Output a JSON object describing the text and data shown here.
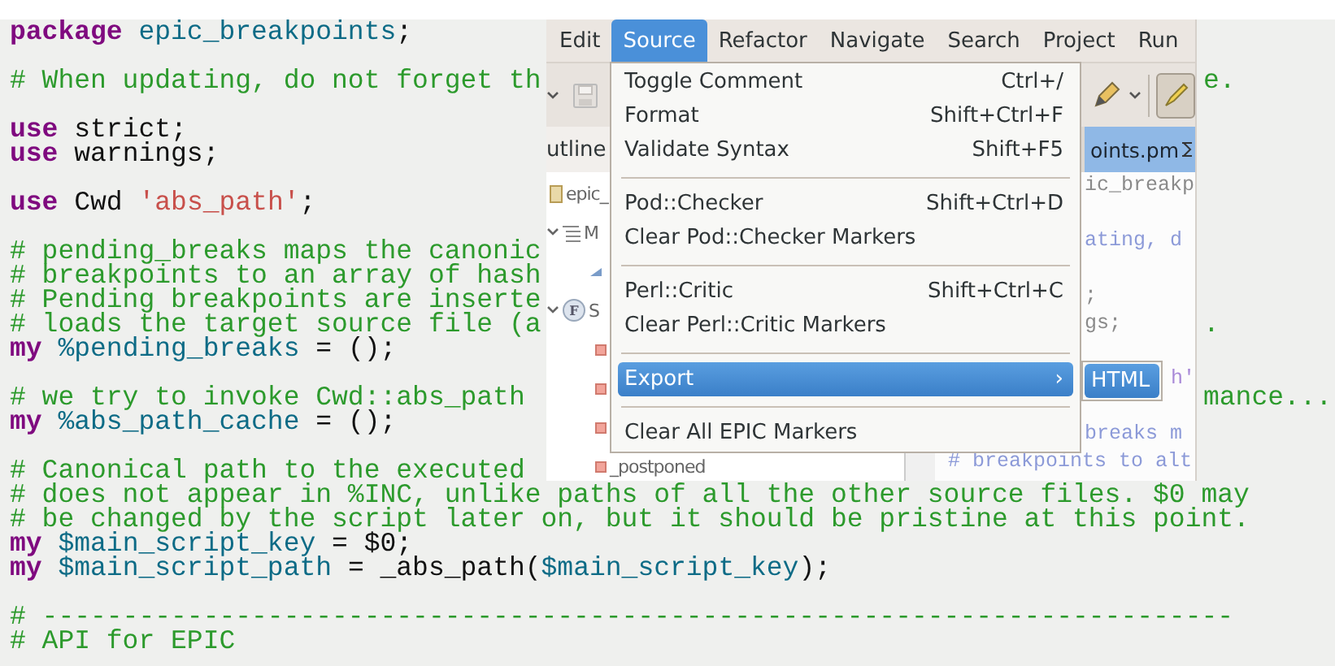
{
  "code": {
    "blocks": [
      [
        {
          "tokens": [
            {
              "kind": "keyword",
              "text": "package"
            },
            {
              "kind": "ident",
              "text": " epic_breakpoints"
            },
            {
              "kind": "plain",
              "text": ";"
            }
          ]
        }
      ],
      [
        {
          "tokens": [
            {
              "kind": "comment",
              "text": "# When updating, do not forget th"
            }
          ],
          "tail": [
            {
              "kind": "comment",
              "text": "e."
            }
          ]
        }
      ],
      [
        {
          "tokens": [
            {
              "kind": "keyword",
              "text": "use"
            },
            {
              "kind": "plain",
              "text": " strict;"
            }
          ]
        },
        {
          "tokens": [
            {
              "kind": "keyword",
              "text": "use"
            },
            {
              "kind": "plain",
              "text": " warnings;"
            }
          ]
        }
      ],
      [
        {
          "tokens": [
            {
              "kind": "keyword",
              "text": "use"
            },
            {
              "kind": "plain",
              "text": " Cwd "
            },
            {
              "kind": "string",
              "text": "'abs_path'"
            },
            {
              "kind": "plain",
              "text": ";"
            }
          ]
        }
      ],
      [
        {
          "tokens": [
            {
              "kind": "comment",
              "text": "# pending_breaks maps the canonic"
            }
          ]
        },
        {
          "tokens": [
            {
              "kind": "comment",
              "text": "# breakpoints to an array of hash"
            }
          ]
        },
        {
          "tokens": [
            {
              "kind": "comment",
              "text": "# Pending breakpoints are inserte"
            }
          ]
        },
        {
          "tokens": [
            {
              "kind": "comment",
              "text": "# loads the target source file (a"
            }
          ],
          "tail": [
            {
              "kind": "comment",
              "text": "."
            }
          ]
        },
        {
          "tokens": [
            {
              "kind": "keyword",
              "text": "my"
            },
            {
              "kind": "ident",
              "text": " %pending_breaks"
            },
            {
              "kind": "plain",
              "text": " = ();"
            }
          ]
        }
      ],
      [
        {
          "tokens": [
            {
              "kind": "comment",
              "text": "# we try to invoke Cwd::abs_path"
            }
          ],
          "tail": [
            {
              "kind": "comment",
              "text": "mance..."
            }
          ]
        },
        {
          "tokens": [
            {
              "kind": "keyword",
              "text": "my"
            },
            {
              "kind": "ident",
              "text": " %abs_path_cache"
            },
            {
              "kind": "plain",
              "text": " = ();"
            }
          ]
        }
      ],
      [
        {
          "tokens": [
            {
              "kind": "comment",
              "text": "# Canonical path to the executed"
            }
          ]
        },
        {
          "tokens": [
            {
              "kind": "comment",
              "text": "# does not appear in %INC, unlike paths of all the other source files. $0 may"
            }
          ]
        },
        {
          "tokens": [
            {
              "kind": "comment",
              "text": "# be changed by the script later on, but it should be pristine at this point."
            }
          ]
        },
        {
          "tokens": [
            {
              "kind": "keyword",
              "text": "my"
            },
            {
              "kind": "ident",
              "text": " $main_script_key"
            },
            {
              "kind": "plain",
              "text": " = $0;"
            }
          ]
        },
        {
          "tokens": [
            {
              "kind": "keyword",
              "text": "my"
            },
            {
              "kind": "ident",
              "text": " $main_script_path"
            },
            {
              "kind": "plain",
              "text": " = _abs_path("
            },
            {
              "kind": "ident",
              "text": "$main_script_key"
            },
            {
              "kind": "plain",
              "text": ");"
            }
          ]
        }
      ],
      [
        {
          "tokens": [
            {
              "kind": "comment",
              "text": "# --------------------------------------------------------------------------"
            }
          ]
        },
        {
          "tokens": [
            {
              "kind": "comment",
              "text": "# API for EPIC"
            }
          ]
        }
      ]
    ]
  },
  "window": {
    "menubar": [
      {
        "label": "Edit",
        "selected": false
      },
      {
        "label": "Source",
        "selected": true
      },
      {
        "label": "Refactor",
        "selected": false
      },
      {
        "label": "Navigate",
        "selected": false
      },
      {
        "label": "Search",
        "selected": false
      },
      {
        "label": "Project",
        "selected": false
      },
      {
        "label": "Run",
        "selected": false
      }
    ],
    "outline_tab": {
      "label": "utline"
    },
    "editor_tab": {
      "label": "oints.pm"
    },
    "tree": [
      {
        "kind": "package",
        "label": "epic_",
        "children": [
          {
            "kind": "list",
            "label": "M",
            "expanded": true,
            "children": [
              {
                "kind": "triangle"
              }
            ]
          },
          {
            "kind": "function",
            "badge": "F",
            "label": "S",
            "expanded": true,
            "children": [
              {
                "kind": "method"
              },
              {
                "kind": "method"
              },
              {
                "kind": "method"
              },
              {
                "kind": "method",
                "label": "_postponed"
              }
            ]
          }
        ]
      }
    ],
    "editor": {
      "blocks": [
        [
          {
            "kind": "cut",
            "tokens": [
              {
                "kind": "code",
                "text": "ic_breakp"
              }
            ]
          }
        ],
        [
          {
            "kind": "cut",
            "tokens": [
              {
                "kind": "comment",
                "text": "ating, d"
              }
            ]
          }
        ],
        [
          {
            "kind": "cut",
            "tokens": [
              {
                "kind": "code",
                "text": ";"
              }
            ]
          },
          {
            "kind": "cut",
            "tokens": [
              {
                "kind": "code",
                "text": "gs;"
              }
            ]
          }
        ],
        [
          {
            "kind": "beside_submenu",
            "tokens": [
              {
                "kind": "string",
                "text": "h'"
              }
            ]
          }
        ],
        [
          {
            "kind": "cut",
            "tokens": [
              {
                "kind": "comment",
                "text": "breaks m"
              }
            ]
          },
          {
            "kind": "whole",
            "tokens": [
              {
                "kind": "comment",
                "text": "# breakpoints to alt"
              }
            ]
          }
        ]
      ]
    }
  },
  "menu": {
    "sections": [
      [
        {
          "label": "Toggle Comment",
          "shortcut": "Ctrl+/",
          "selected": false
        },
        {
          "label": "Format",
          "shortcut": "Shift+Ctrl+F",
          "selected": false
        },
        {
          "label": "Validate Syntax",
          "shortcut": "Shift+F5",
          "selected": false
        }
      ],
      [
        {
          "label": "Pod::Checker",
          "shortcut": "Shift+Ctrl+D",
          "selected": false
        },
        {
          "label": "Clear Pod::Checker Markers",
          "selected": false
        }
      ],
      [
        {
          "label": "Perl::Critic",
          "shortcut": "Shift+Ctrl+C",
          "selected": false
        },
        {
          "label": "Clear Perl::Critic Markers",
          "selected": false
        }
      ],
      [
        {
          "label": "Export",
          "arrow": "›",
          "selected": true
        }
      ],
      [
        {
          "label": "Clear All EPIC Markers",
          "selected": false
        }
      ]
    ],
    "submenu": [
      {
        "label": "HTML",
        "selected": true
      }
    ]
  }
}
